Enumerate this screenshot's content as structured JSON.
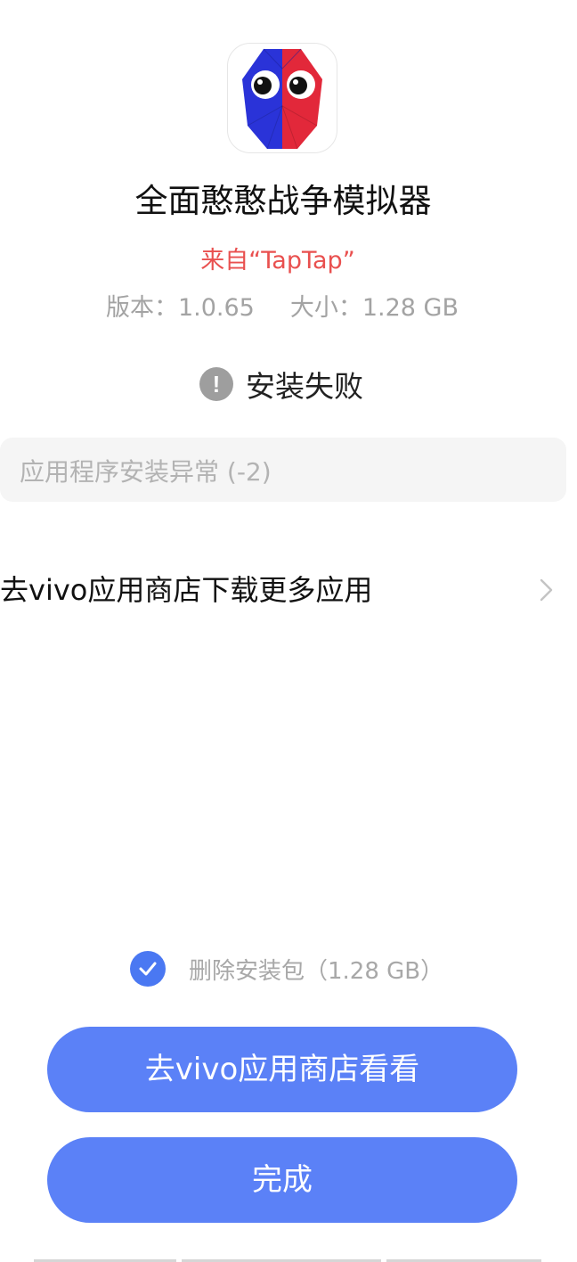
{
  "app": {
    "name": "全面憨憨战争模拟器",
    "source": "来自“TapTap”",
    "version_label": "版本：1.0.65",
    "size_label": "大小：1.28 GB",
    "icon": "app-icon"
  },
  "status": {
    "icon": "exclamation-icon",
    "text": "安装失败"
  },
  "error": {
    "message": "应用程序安装异常 (-2)"
  },
  "store_link": {
    "label": "去vivo应用商店下载更多应用",
    "icon": "chevron-right-icon"
  },
  "delete_package": {
    "checked": true,
    "label": "删除安装包（1.28 GB）"
  },
  "buttons": {
    "store": "去vivo应用商店看看",
    "done": "完成"
  },
  "colors": {
    "accent": "#5b81f7",
    "source_red": "#e9504f",
    "muted_text": "#a3a3a3"
  }
}
